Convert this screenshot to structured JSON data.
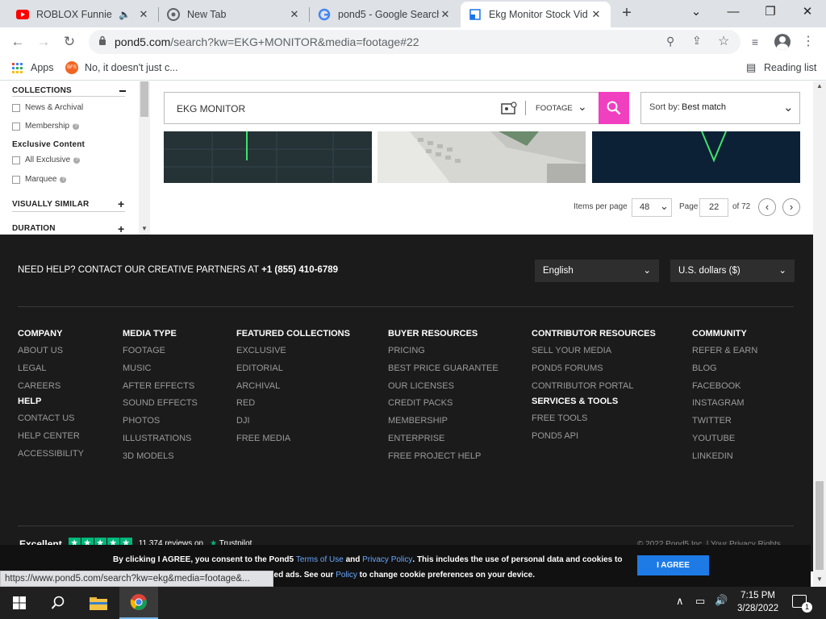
{
  "browser": {
    "tabs": [
      {
        "title": "ROBLOX Funniest M",
        "icon": "youtube-icon"
      },
      {
        "title": "New Tab",
        "icon": "chrome-icon"
      },
      {
        "title": "pond5 - Google Search",
        "icon": "google-icon"
      },
      {
        "title": "Ekg Monitor Stock Vid",
        "icon": "pond5-icon"
      }
    ],
    "url_host": "pond5.com",
    "url_path": "/search?kw=EKG+MONITOR&media=footage#22",
    "bookmarks": {
      "apps": "Apps",
      "item": "No, it doesn't just c...",
      "reading_list": "Reading list"
    }
  },
  "sidebar": {
    "collections": "COLLECTIONS",
    "news": "News & Archival",
    "membership": "Membership",
    "exclusive_content": "Exclusive Content",
    "all_exclusive": "All Exclusive",
    "marquee": "Marquee",
    "visually_similar": "VISUALLY SIMILAR",
    "duration": "DURATION"
  },
  "search": {
    "query": "EKG MONITOR",
    "media_type": "FOOTAGE",
    "sort_label": "Sort by:",
    "sort_value": "Best match"
  },
  "pagination": {
    "items_per_page_label": "Items per page",
    "items_per_page": "48",
    "page_label": "Page",
    "page": "22",
    "of_label": "of 72"
  },
  "footer": {
    "help_text": "NEED HELP? CONTACT OUR CREATIVE PARTNERS AT",
    "phone": "+1 (855) 410-6789",
    "language": "English",
    "currency": "U.S. dollars ($)",
    "columns": {
      "company": {
        "title": "COMPANY",
        "links": [
          "ABOUT US",
          "LEGAL",
          "CAREERS"
        ]
      },
      "help": {
        "title": "HELP",
        "links": [
          "CONTACT US",
          "HELP CENTER",
          "ACCESSIBILITY"
        ]
      },
      "media": {
        "title": "MEDIA TYPE",
        "links": [
          "FOOTAGE",
          "MUSIC",
          "AFTER EFFECTS",
          "SOUND EFFECTS",
          "PHOTOS",
          "ILLUSTRATIONS",
          "3D MODELS"
        ]
      },
      "featured": {
        "title": "FEATURED COLLECTIONS",
        "links": [
          "EXCLUSIVE",
          "EDITORIAL",
          "ARCHIVAL",
          "RED",
          "DJI",
          "FREE MEDIA"
        ]
      },
      "buyer": {
        "title": "BUYER RESOURCES",
        "links": [
          "PRICING",
          "BEST PRICE GUARANTEE",
          "OUR LICENSES",
          "CREDIT PACKS",
          "MEMBERSHIP",
          "ENTERPRISE",
          "FREE PROJECT HELP"
        ]
      },
      "contributor": {
        "title": "CONTRIBUTOR RESOURCES",
        "links": [
          "SELL YOUR MEDIA",
          "POND5 FORUMS",
          "CONTRIBUTOR PORTAL"
        ]
      },
      "services": {
        "title": "SERVICES & TOOLS",
        "links": [
          "FREE TOOLS",
          "POND5 API"
        ]
      },
      "community": {
        "title": "COMMUNITY",
        "links": [
          "REFER & EARN",
          "BLOG",
          "FACEBOOK",
          "INSTAGRAM",
          "TWITTER",
          "YOUTUBE",
          "LINKEDIN"
        ]
      }
    },
    "trust_excellent": "Excellent",
    "trust_reviews": "11,374 reviews on",
    "trust_brand": "Trustpilot",
    "copyright": "© 2022 Pond5 Inc. | Your Privacy Rights"
  },
  "cookie": {
    "p1": "By clicking I AGREE, you consent to the Pond5 ",
    "terms": "Terms of Use",
    "and": " and ",
    "privacy": "Privacy Policy",
    "p2": ". This includes the use of personal data and cookies to enhance site usage and enable personalized ads. See our ",
    "policy": "Policy",
    "p3": " to change cookie preferences on your device.",
    "button": "I AGREE"
  },
  "status_url": "https://www.pond5.com/search?kw=ekg&media=footage&...",
  "taskbar": {
    "time": "7:15 PM",
    "date": "3/28/2022",
    "notif_count": "1"
  },
  "colors": {
    "accent_pink": "#f03fbf",
    "agree_blue": "#1e7be6",
    "footer_bg": "#1b1b1b",
    "ekg_green": "#3ee36a"
  }
}
